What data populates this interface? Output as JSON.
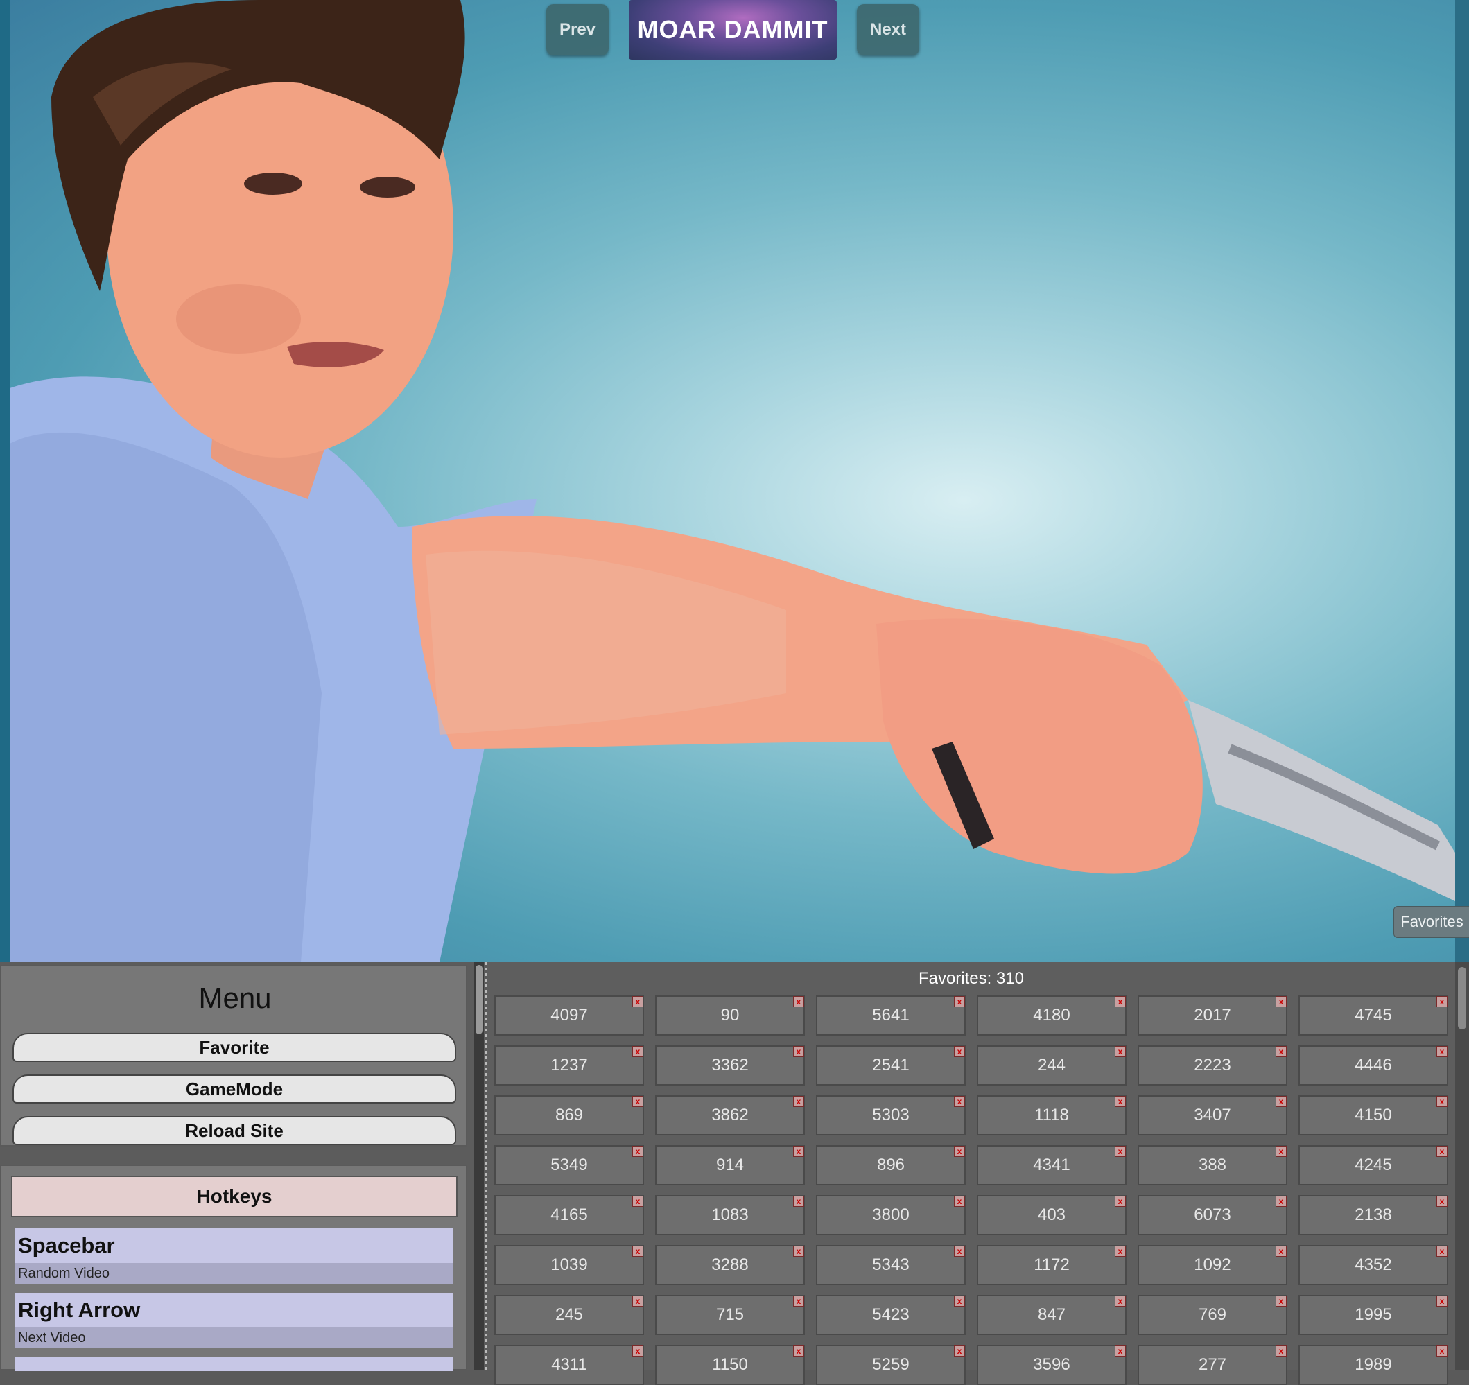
{
  "nav": {
    "prev_label": "Prev",
    "moar_label": "MOAR DAMMIT",
    "next_label": "Next"
  },
  "favorites_tab_label": "Favorites",
  "menu": {
    "title": "Menu",
    "buttons": [
      "Favorite",
      "GameMode",
      "Reload Site"
    ]
  },
  "hotkeys": {
    "title": "Hotkeys",
    "items": [
      {
        "key": "Spacebar",
        "desc": "Random Video"
      },
      {
        "key": "Right Arrow",
        "desc": "Next Video"
      }
    ]
  },
  "favorites": {
    "title": "Favorites: 310",
    "remove_glyph": "x",
    "rows": [
      [
        "4097",
        "90",
        "5641",
        "4180",
        "2017",
        "4745"
      ],
      [
        "1237",
        "3362",
        "2541",
        "244",
        "2223",
        "4446"
      ],
      [
        "869",
        "3862",
        "5303",
        "1118",
        "3407",
        "4150"
      ],
      [
        "5349",
        "914",
        "896",
        "4341",
        "388",
        "4245"
      ],
      [
        "4165",
        "1083",
        "3800",
        "403",
        "6073",
        "2138"
      ],
      [
        "1039",
        "3288",
        "5343",
        "1172",
        "1092",
        "4352"
      ],
      [
        "245",
        "715",
        "5423",
        "847",
        "769",
        "1995"
      ],
      [
        "4311",
        "1150",
        "5259",
        "3596",
        "277",
        "1989"
      ]
    ]
  },
  "colors": {
    "moar_accent": "#6a4f9a",
    "hotkeys_header": "#e4cfcf",
    "hotkey_row": "#c7c7e6"
  }
}
